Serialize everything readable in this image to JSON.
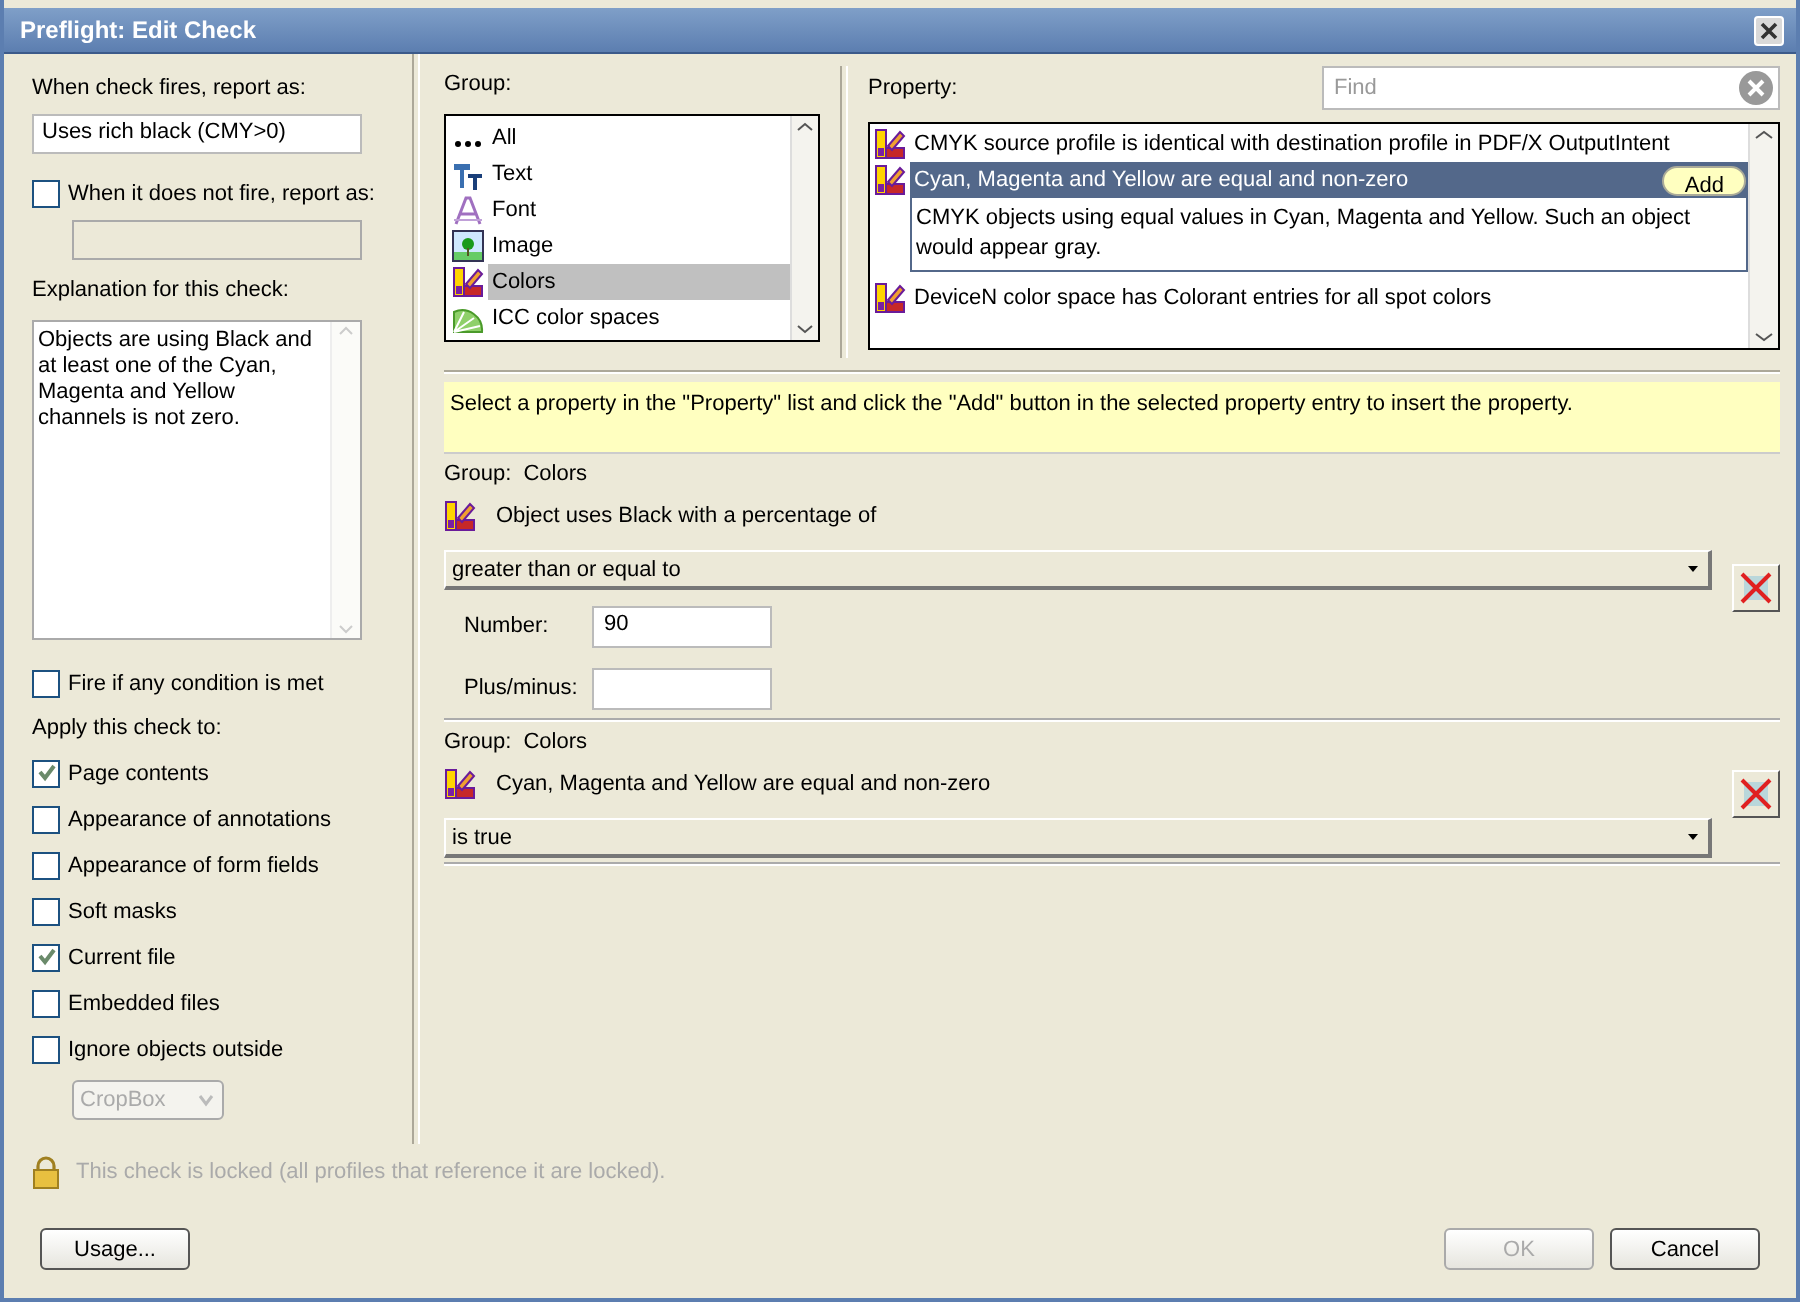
{
  "window": {
    "title": "Preflight: Edit Check"
  },
  "left": {
    "report_label": "When check fires, report as:",
    "report_value": "Uses rich black (CMY>0)",
    "not_fire": {
      "label": "When it does not fire, report as:",
      "checked": false
    },
    "explanation_label": "Explanation for this check:",
    "explanation_text": "Objects are using Black and at least one of the Cyan, Magenta and Yellow channels is not zero.",
    "fire_any": {
      "label": "Fire if any condition is met",
      "checked": false
    },
    "apply_label": "Apply this check to:",
    "apply_items": [
      {
        "label": "Page contents",
        "checked": true
      },
      {
        "label": "Appearance of annotations",
        "checked": false
      },
      {
        "label": "Appearance of form fields",
        "checked": false
      },
      {
        "label": "Soft masks",
        "checked": false
      },
      {
        "label": "Current file",
        "checked": true
      },
      {
        "label": "Embedded files",
        "checked": false
      },
      {
        "label": "Ignore objects outside",
        "checked": false
      }
    ],
    "box_select": {
      "value": "CropBox",
      "disabled": true
    }
  },
  "group": {
    "label": "Group:",
    "items": [
      {
        "label": "All",
        "kind": "all",
        "selected": false
      },
      {
        "label": "Text",
        "kind": "text",
        "selected": false
      },
      {
        "label": "Font",
        "kind": "font",
        "selected": false
      },
      {
        "label": "Image",
        "kind": "image",
        "selected": false
      },
      {
        "label": "Colors",
        "kind": "colors",
        "selected": true
      },
      {
        "label": "ICC color spaces",
        "kind": "icc",
        "selected": false
      }
    ]
  },
  "property": {
    "label": "Property:",
    "search": {
      "placeholder": "Find"
    },
    "add_button": "Add",
    "items": [
      {
        "label": "CMYK source profile is identical with destination profile in PDF/X OutputIntent",
        "selected": false
      },
      {
        "label": "Cyan, Magenta and Yellow are equal and non-zero",
        "selected": true,
        "description": "CMYK objects using equal values in Cyan, Magenta and Yellow. Such an object would appear gray."
      },
      {
        "label": "DeviceN color space has Colorant entries for all spot colors",
        "selected": false
      }
    ]
  },
  "hint": "Select a property in the \"Property\" list and click the \"Add\" button in the selected property entry to insert the property.",
  "conditions": [
    {
      "group_label": "Group:",
      "group": "Colors",
      "property": "Object uses Black with a percentage of",
      "operator": "greater than or equal to",
      "fields": [
        {
          "label": "Number:",
          "value": "90"
        },
        {
          "label": "Plus/minus:"
        }
      ]
    },
    {
      "group_label": "Group:",
      "group": "Colors",
      "property": "Cyan, Magenta and Yellow are equal and non-zero",
      "operator": "is true"
    }
  ],
  "lock_text": "This check is locked (all profiles that reference it are locked).",
  "buttons": [
    {
      "label": "Usage...",
      "kind": "usage",
      "disabled": false
    },
    {
      "label": "OK",
      "kind": "ok",
      "disabled": true
    },
    {
      "label": "Cancel",
      "kind": "cancel",
      "disabled": false
    }
  ]
}
